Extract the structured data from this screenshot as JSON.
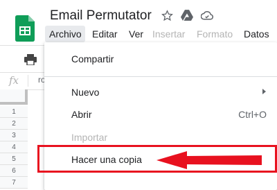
{
  "app": {
    "title": "Email Permutator",
    "logo_icon": "google-sheets-icon",
    "title_icons": [
      "star-icon",
      "drive-move-icon",
      "cloud-status-icon"
    ]
  },
  "menubar": {
    "items": [
      {
        "label": "Archivo",
        "active": true
      },
      {
        "label": "Editar"
      },
      {
        "label": "Ver"
      },
      {
        "label": "Insertar",
        "disabled": true
      },
      {
        "label": "Formato",
        "disabled": true
      },
      {
        "label": "Datos"
      }
    ]
  },
  "toolbar": {
    "print_icon": "printer-icon"
  },
  "formula_bar": {
    "fx": "fx",
    "cell_ref": "ro"
  },
  "grid": {
    "row_numbers": [
      "1",
      "2",
      "3",
      "4",
      "5",
      "6",
      "7"
    ]
  },
  "file_menu": {
    "items": [
      {
        "label": "Compartir"
      },
      {
        "label": "Nuevo",
        "submenu": true
      },
      {
        "label": "Abrir",
        "shortcut": "Ctrl+O"
      },
      {
        "label": "Importar",
        "disabled": true
      },
      {
        "label": "Hacer una copia",
        "highlighted": true
      }
    ]
  },
  "colors": {
    "sheets_green": "#0f9d58",
    "highlight_red": "#e8111f",
    "menu_active_bg": "#e8eaed",
    "disabled_text": "#b4b4b4"
  }
}
